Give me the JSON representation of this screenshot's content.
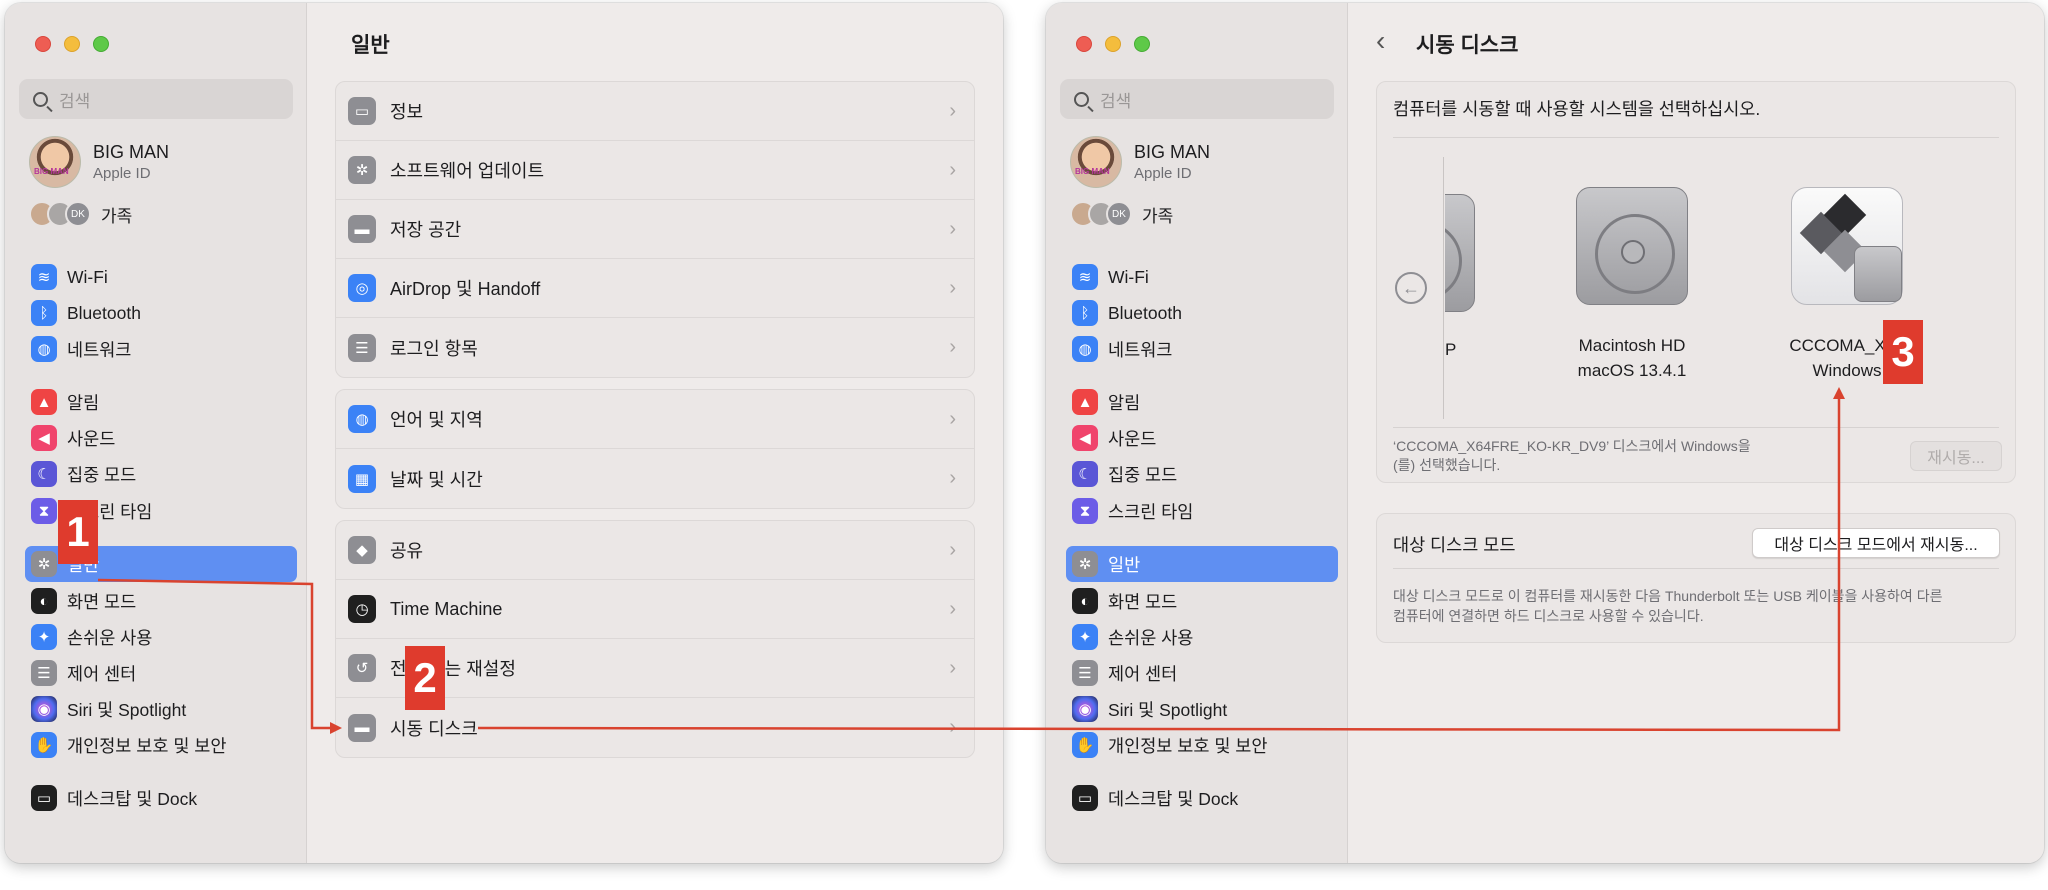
{
  "search_placeholder": "검색",
  "profile": {
    "name": "BIG MAN",
    "subtitle": "Apple ID"
  },
  "family": {
    "initials": "DK",
    "label": "가족"
  },
  "sidebar_items": [
    {
      "label": "Wi-Fi",
      "icon": "wifi-icon"
    },
    {
      "label": "Bluetooth",
      "icon": "bluetooth-icon"
    },
    {
      "label": "네트워크",
      "icon": "globe-icon"
    },
    {
      "label": "알림",
      "icon": "bell-icon"
    },
    {
      "label": "사운드",
      "icon": "speaker-icon"
    },
    {
      "label": "집중 모드",
      "icon": "moon-icon"
    },
    {
      "label": "스크린 타임",
      "icon": "hourglass-icon"
    },
    {
      "label": "일반",
      "icon": "gear-icon",
      "selected": true
    },
    {
      "label": "화면 모드",
      "icon": "appearance-icon"
    },
    {
      "label": "손쉬운 사용",
      "icon": "accessibility-icon"
    },
    {
      "label": "제어 센터",
      "icon": "control-center-icon"
    },
    {
      "label": "Siri 및 Spotlight",
      "icon": "siri-icon"
    },
    {
      "label": "개인정보 보호 및 보안",
      "icon": "hand-icon"
    },
    {
      "label": "데스크탑 및 Dock",
      "icon": "dock-icon"
    }
  ],
  "left": {
    "title": "일반",
    "groups": [
      [
        {
          "label": "정보",
          "icon": "laptop-icon"
        },
        {
          "label": "소프트웨어 업데이트",
          "icon": "gear-badge-icon"
        },
        {
          "label": "저장 공간",
          "icon": "drive-icon"
        },
        {
          "label": "AirDrop 및 Handoff",
          "icon": "airdrop-icon"
        },
        {
          "label": "로그인 항목",
          "icon": "list-icon"
        }
      ],
      [
        {
          "label": "언어 및 지역",
          "icon": "globe-icon"
        },
        {
          "label": "날짜 및 시간",
          "icon": "calendar-icon"
        }
      ],
      [
        {
          "label": "공유",
          "icon": "share-icon"
        },
        {
          "label": "Time Machine",
          "icon": "time-machine-icon"
        },
        {
          "label": "전송 또는 재설정",
          "icon": "reset-icon"
        },
        {
          "label": "시동 디스크",
          "icon": "startup-disk-icon"
        }
      ]
    ]
  },
  "right": {
    "back_symbol": "‹",
    "title": "시동 디스크",
    "prompt": "컴퓨터를 시동할 때 사용할 시스템을 선택하십시오.",
    "disks": [
      {
        "name": "P",
        "os": ""
      },
      {
        "name": "Macintosh HD",
        "os": "macOS 13.4.1"
      },
      {
        "name": "CCCOMA_X64",
        "os": "Windows"
      }
    ],
    "status_line1": "‘CCCOMA_X64FRE_KO-KR_DV9’ 디스크에서 Windows을",
    "status_line2": "(를) 선택했습니다.",
    "restart_label": "재시동...",
    "target_title": "대상 디스크 모드",
    "target_button": "대상 디스크 모드에서 재시동...",
    "target_desc1": "대상 디스크 모드로 이 컴퓨터를 재시동한 다음 Thunderbolt 또는 USB 케이블을 사용하여 다른",
    "target_desc2": "컴퓨터에 연결하면 하드 디스크로 사용할 수 있습니다."
  },
  "annotations": [
    "1",
    "2",
    "3"
  ],
  "colors": {
    "accent": "#5f8ff2",
    "annotation": "#df3b2d"
  }
}
